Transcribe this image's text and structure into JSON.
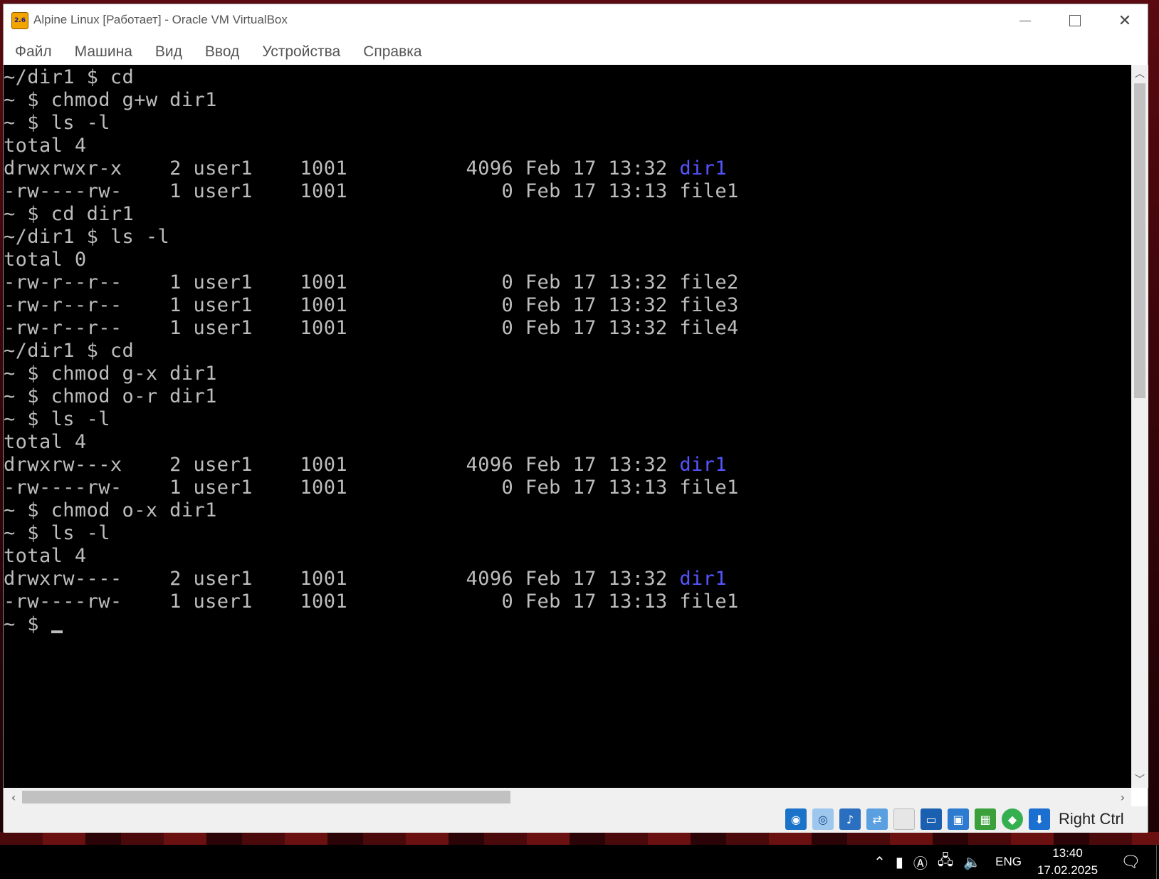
{
  "window": {
    "title": "Alpine Linux [Работает] - Oracle VM VirtualBox",
    "app_icon_text": "2.6"
  },
  "menu": [
    "Файл",
    "Машина",
    "Вид",
    "Ввод",
    "Устройства",
    "Справка"
  ],
  "terminal": {
    "lines": [
      [
        {
          "t": "~/dir1 $ cd"
        }
      ],
      [
        {
          "t": "~ $ chmod g+w dir1"
        }
      ],
      [
        {
          "t": "~ $ ls -l"
        }
      ],
      [
        {
          "t": "total 4"
        }
      ],
      [
        {
          "t": "drwxrwxr-x    2 user1    1001          4096 Feb 17 13:32 "
        },
        {
          "t": "dir1",
          "dir": true
        }
      ],
      [
        {
          "t": "-rw----rw-    1 user1    1001             0 Feb 17 13:13 file1"
        }
      ],
      [
        {
          "t": "~ $ cd dir1"
        }
      ],
      [
        {
          "t": "~/dir1 $ ls -l"
        }
      ],
      [
        {
          "t": "total 0"
        }
      ],
      [
        {
          "t": "-rw-r--r--    1 user1    1001             0 Feb 17 13:32 file2"
        }
      ],
      [
        {
          "t": "-rw-r--r--    1 user1    1001             0 Feb 17 13:32 file3"
        }
      ],
      [
        {
          "t": "-rw-r--r--    1 user1    1001             0 Feb 17 13:32 file4"
        }
      ],
      [
        {
          "t": "~/dir1 $ cd"
        }
      ],
      [
        {
          "t": "~ $ chmod g-x dir1"
        }
      ],
      [
        {
          "t": "~ $ chmod o-r dir1"
        }
      ],
      [
        {
          "t": "~ $ ls -l"
        }
      ],
      [
        {
          "t": "total 4"
        }
      ],
      [
        {
          "t": "drwxrw---x    2 user1    1001          4096 Feb 17 13:32 "
        },
        {
          "t": "dir1",
          "dir": true
        }
      ],
      [
        {
          "t": "-rw----rw-    1 user1    1001             0 Feb 17 13:13 file1"
        }
      ],
      [
        {
          "t": "~ $ chmod o-x dir1"
        }
      ],
      [
        {
          "t": "~ $ ls -l"
        }
      ],
      [
        {
          "t": "total 4"
        }
      ],
      [
        {
          "t": "drwxrw----    2 user1    1001          4096 Feb 17 13:32 "
        },
        {
          "t": "dir1",
          "dir": true
        }
      ],
      [
        {
          "t": "-rw----rw-    1 user1    1001             0 Feb 17 13:13 file1"
        }
      ],
      [
        {
          "t": "~ $ "
        },
        {
          "cursor": true
        }
      ]
    ],
    "colors": {
      "fg": "#bdbdbd",
      "dir": "#5555ff",
      "bg": "#000000"
    }
  },
  "statusbar": {
    "icons": [
      "hard-disk-icon",
      "optical-drive-icon",
      "audio-icon",
      "network-icon",
      "usb-icon",
      "display-icon",
      "shared-folders-icon",
      "video-capture-icon",
      "cpu-icon",
      "mouse-integration-icon"
    ],
    "host_key": "Right Ctrl"
  },
  "taskbar": {
    "language": "ENG",
    "time": "13:40",
    "date": "17.02.2025"
  }
}
